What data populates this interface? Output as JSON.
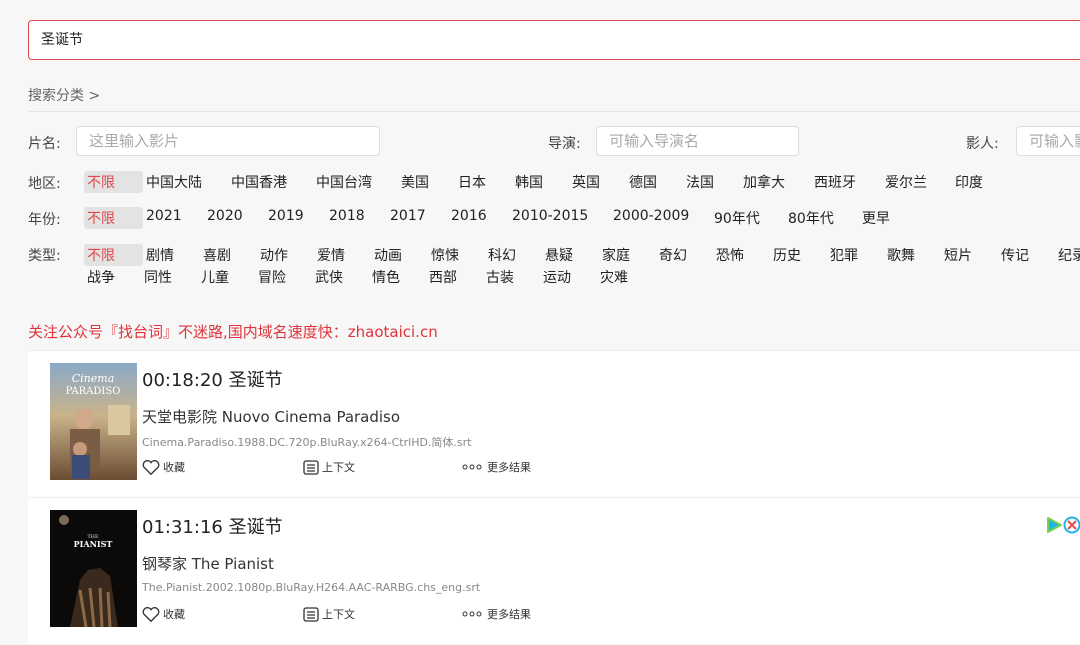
{
  "search": {
    "value": "圣诞节"
  },
  "category_title": "搜索分类 >",
  "filters": {
    "title_label": "片名:",
    "title_placeholder": "这里输入影片",
    "director_label": "导演:",
    "director_placeholder": "可输入导演名",
    "actor_label": "影人:",
    "actor_placeholder": "可输入影",
    "region_label": "地区:",
    "regions": [
      "不限",
      "中国大陆",
      "中国香港",
      "中国台湾",
      "美国",
      "日本",
      "韩国",
      "英国",
      "德国",
      "法国",
      "加拿大",
      "西班牙",
      "爱尔兰",
      "印度"
    ],
    "year_label": "年份:",
    "years": [
      "不限",
      "2021",
      "2020",
      "2019",
      "2018",
      "2017",
      "2016",
      "2010-2015",
      "2000-2009",
      "90年代",
      "80年代",
      "更早"
    ],
    "genre_label": "类型:",
    "genres_row1": [
      "不限",
      "剧情",
      "喜剧",
      "动作",
      "爱情",
      "动画",
      "惊悚",
      "科幻",
      "悬疑",
      "家庭",
      "奇幻",
      "恐怖",
      "历史",
      "犯罪",
      "歌舞",
      "短片",
      "传记",
      "纪录"
    ],
    "genres_row2": [
      "战争",
      "同性",
      "儿童",
      "冒险",
      "武侠",
      "情色",
      "西部",
      "古装",
      "运动",
      "灾难"
    ]
  },
  "notice": "关注公众号『找台词』不迷路,国内域名速度快：zhaotaici.cn",
  "results": [
    {
      "title": "00:18:20 圣诞节",
      "name": "天堂电影院 Nuovo Cinema Paradiso",
      "file": "Cinema.Paradiso.1988.DC.720p.BluRay.x264-CtrlHD.简体.srt",
      "poster_text1": "Cinema",
      "poster_text2": "PARADISO",
      "fav": "收藏",
      "context": "上下文",
      "more": "更多结果"
    },
    {
      "title": "01:31:16 圣诞节",
      "name": "钢琴家 The Pianist",
      "file": "The.Pianist.2002.1080p.BluRay.H264.AAC-RARBG.chs_eng.srt",
      "poster_text1": "THE",
      "poster_text2": "PIANIST",
      "fav": "收藏",
      "context": "上下文",
      "more": "更多结果"
    }
  ],
  "colors": {
    "accent": "#e0484b",
    "notice": "#e0333b"
  }
}
